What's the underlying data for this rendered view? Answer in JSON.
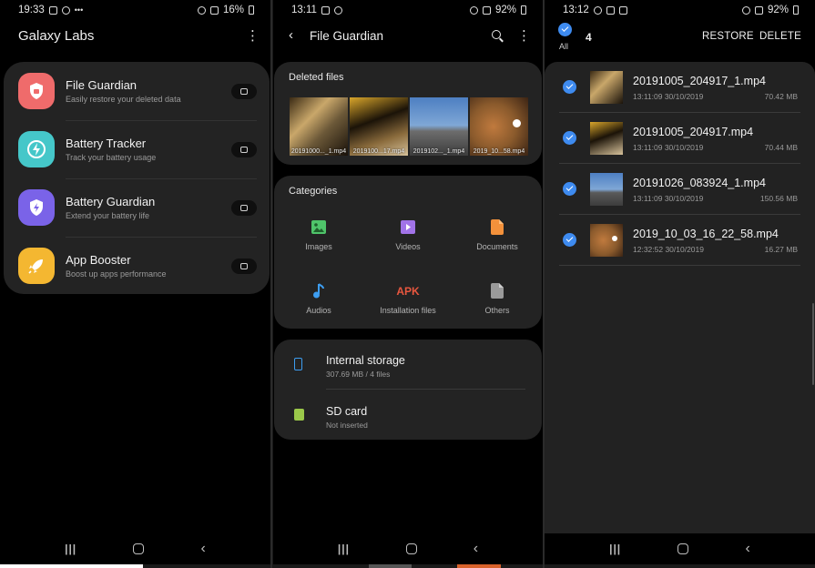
{
  "screen1": {
    "status": {
      "time": "19:33",
      "battery": "16%"
    },
    "title": "Galaxy Labs",
    "items": [
      {
        "title": "File Guardian",
        "subtitle": "Easily restore your deleted data",
        "icon": "shield-icon",
        "color": "#ef6b6b"
      },
      {
        "title": "Battery Tracker",
        "subtitle": "Track your battery usage",
        "icon": "battery-bolt-icon",
        "color": "#45c7c9"
      },
      {
        "title": "Battery Guardian",
        "subtitle": "Extend your battery life",
        "icon": "battery-shield-icon",
        "color": "#7a63e8"
      },
      {
        "title": "App Booster",
        "subtitle": "Boost up apps performance",
        "icon": "rocket-icon",
        "color": "#f4b731"
      }
    ]
  },
  "screen2": {
    "status": {
      "time": "13:11",
      "battery": "92%"
    },
    "title": "File Guardian",
    "deleted_files_title": "Deleted files",
    "deleted_thumbs": [
      {
        "label": "20191000..._1.mp4"
      },
      {
        "label": "2019100...17.mp4"
      },
      {
        "label": "2019102..._1.mp4"
      },
      {
        "label": "2019_10...58.mp4"
      }
    ],
    "categories_title": "Categories",
    "categories": [
      {
        "label": "Images",
        "icon": "image-icon",
        "color": "#4fc46a"
      },
      {
        "label": "Videos",
        "icon": "video-icon",
        "color": "#a173e8"
      },
      {
        "label": "Documents",
        "icon": "document-icon",
        "color": "#f3913b"
      },
      {
        "label": "Audios",
        "icon": "audio-icon",
        "color": "#3d9df0"
      },
      {
        "label": "Installation files",
        "icon_text": "APK",
        "color": "#e8573f"
      },
      {
        "label": "Others",
        "icon": "other-file-icon",
        "color": "#9a9a9a"
      }
    ],
    "storage": [
      {
        "title": "Internal storage",
        "subtitle": "307.69 MB / 4 files",
        "color": "#3d9df0"
      },
      {
        "title": "SD card",
        "subtitle": "Not inserted",
        "color": "#9bc84a"
      }
    ]
  },
  "screen3": {
    "status": {
      "time": "13:12",
      "battery": "92%"
    },
    "all_label": "All",
    "selected_count": "4",
    "restore_label": "RESTORE",
    "delete_label": "DELETE",
    "files": [
      {
        "name": "20191005_204917_1.mp4",
        "date": "13:11:09 30/10/2019",
        "size": "70.42 MB"
      },
      {
        "name": "20191005_204917.mp4",
        "date": "13:11:09 30/10/2019",
        "size": "70.44 MB"
      },
      {
        "name": "20191026_083924_1.mp4",
        "date": "13:11:09 30/10/2019",
        "size": "150.56 MB"
      },
      {
        "name": "2019_10_03_16_22_58.mp4",
        "date": "12:32:52 30/10/2019",
        "size": "16.27 MB"
      }
    ]
  }
}
